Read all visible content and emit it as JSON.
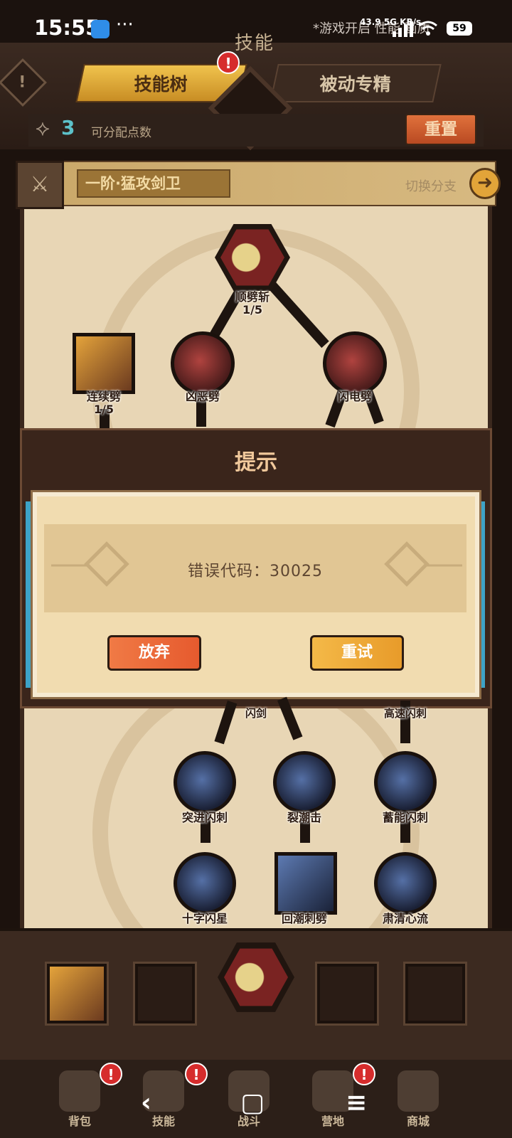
{
  "status_bar": {
    "time": "15:55",
    "dots": "···",
    "right_text": "*游戏开启 性能 画质",
    "speed": "43.9 5G KB/s",
    "battery": "59"
  },
  "header": {
    "title": "技能",
    "tabs": [
      {
        "label": "技能树",
        "active": true
      },
      {
        "label": "被动专精",
        "active": false
      }
    ],
    "warn_icon_text": "!",
    "badge_text": "!"
  },
  "points": {
    "value": "3",
    "label": "可分配点数",
    "reset_label": "重置"
  },
  "branch": {
    "name": "一阶·猛攻剑卫",
    "switch_label": "切换分支",
    "switch_arrow": "➜"
  },
  "tree": {
    "top_skill": {
      "name": "顺劈斩",
      "level": "1/5"
    },
    "row2": [
      {
        "name": "连续劈",
        "level": "1/5"
      },
      {
        "name": "凶恶劈",
        "level": ""
      },
      {
        "name": "闪电劈",
        "level": ""
      }
    ],
    "partial_labels": [
      "闪剑",
      "高速闪刺"
    ],
    "row5": [
      {
        "name": "突进闪刺"
      },
      {
        "name": "裂潮击"
      },
      {
        "name": "蓄能闪刺"
      }
    ],
    "row6": [
      {
        "name": "十字闪星"
      },
      {
        "name": "回潮刺劈"
      },
      {
        "name": "肃清心流"
      }
    ]
  },
  "dialog": {
    "title": "提示",
    "message": "错误代码：30025",
    "buttons": {
      "give_up": "放弃",
      "retry": "重试"
    }
  },
  "bottom_nav": [
    {
      "label": "背包",
      "badge": "!"
    },
    {
      "label": "技能",
      "badge": "!"
    },
    {
      "label": "战斗",
      "badge": ""
    },
    {
      "label": "营地",
      "badge": "!"
    },
    {
      "label": "商城",
      "badge": ""
    }
  ],
  "system_nav": {
    "back": "‹",
    "home": "▢",
    "menu": "≡"
  },
  "colors": {
    "accent_gold": "#e8a93a",
    "reset_orange": "#c9562a",
    "give_up_orange": "#ea6536",
    "retry_gold": "#efab38",
    "points_teal": "#5cc1c9"
  }
}
